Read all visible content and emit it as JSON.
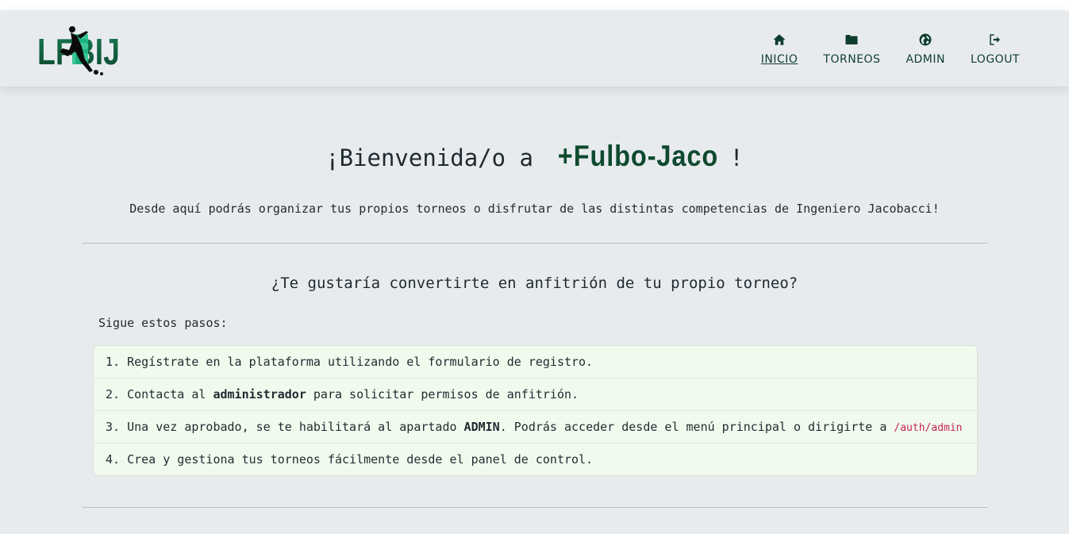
{
  "logo": {
    "text": "LFBIJ"
  },
  "nav": {
    "items": [
      {
        "label": "INICIO",
        "icon": "home-icon",
        "active": true
      },
      {
        "label": "TORNEOS",
        "icon": "folder-icon",
        "active": false
      },
      {
        "label": "ADMIN",
        "icon": "globe-icon",
        "active": false
      },
      {
        "label": "LOGOUT",
        "icon": "logout-icon",
        "active": false
      }
    ]
  },
  "hero": {
    "welcome_prefix": "¡Bienvenida/o a ",
    "brand": "+Fulbo-Jaco",
    "welcome_suffix": "!",
    "subtitle": "Desde aquí podrás organizar tus propios torneos o disfrutar de las distintas competencias de Ingeniero Jacobacci!"
  },
  "host": {
    "question": "¿Te gustaría convertirte en anfitrión de tu propio torneo?",
    "steps_label": "Sigue estos pasos:",
    "step1": "1. Regístrate en la plataforma utilizando el formulario de registro.",
    "step2_pre": "2. Contacta al ",
    "step2_bold": "administrador",
    "step2_post": " para solicitar permisos de anfitrión.",
    "step3_pre": "3. Una vez aprobado, se te habilitará al apartado ",
    "step3_bold": "ADMIN",
    "step3_post": ". Podrás acceder desde el menú principal o dirigirte a ",
    "step3_code": "/auth/admin",
    "step4": "4. Crea y gestiona tus torneos fácilmente desde el panel de control."
  },
  "colors": {
    "brand_green": "#0f4a2e",
    "logo_accent": "#1fc08a",
    "code_pink": "#c7254e",
    "steps_bg": "#f0fbee"
  }
}
